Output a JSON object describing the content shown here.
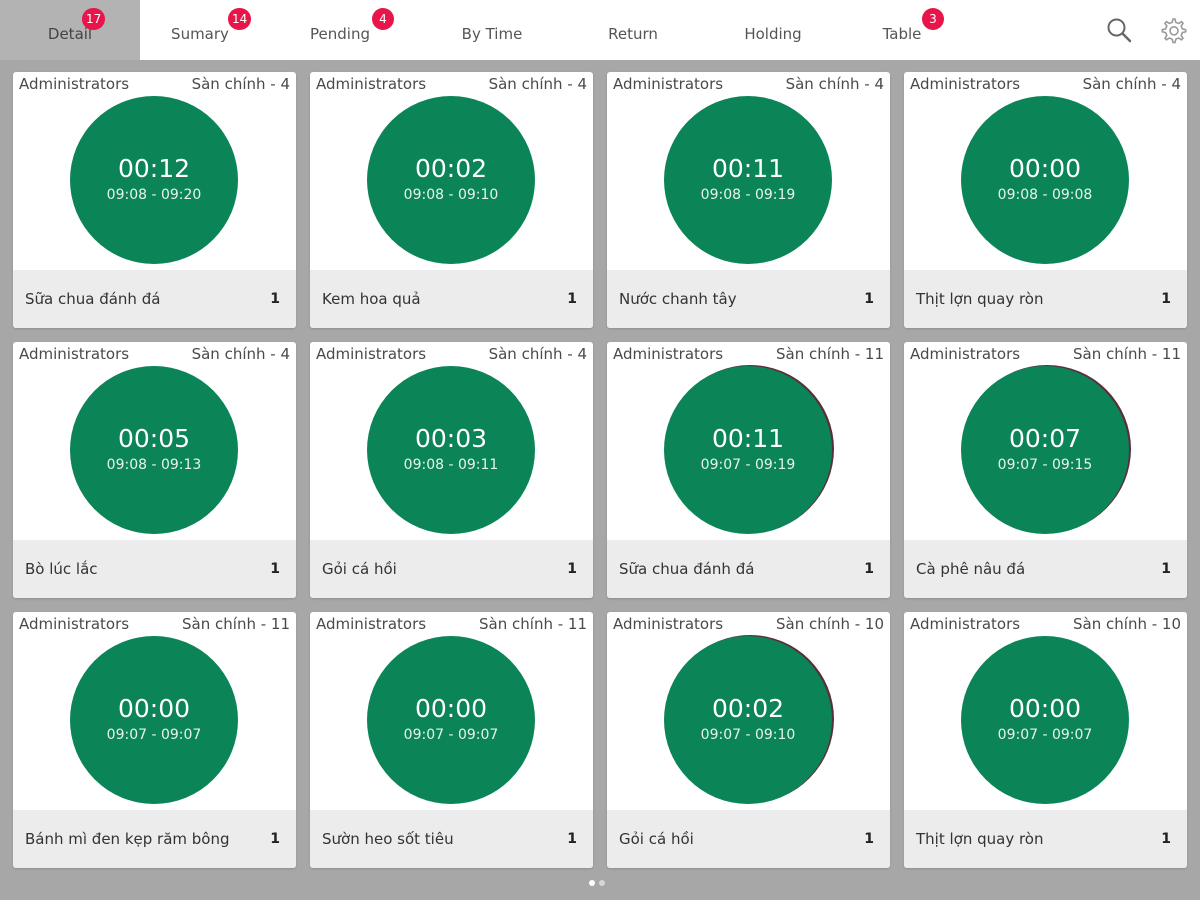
{
  "tabs": [
    {
      "label": "Detail",
      "badge": "17"
    },
    {
      "label": "Sumary",
      "badge": "14"
    },
    {
      "label": "Pending",
      "badge": "4"
    },
    {
      "label": "By Time",
      "badge": ""
    },
    {
      "label": "Return",
      "badge": ""
    },
    {
      "label": "Holding",
      "badge": ""
    },
    {
      "label": "Table",
      "badge": "3"
    }
  ],
  "active_tab": "Detail",
  "tools": {
    "search_icon": "search-icon",
    "settings_icon": "gear-icon"
  },
  "colors": {
    "accent_green": "#0b8457",
    "badge_red": "#e8154a",
    "background": "#a7a7a7"
  },
  "orders": [
    {
      "user": "Administrators",
      "table": "Sàn chính - 4",
      "elapsed": "00:12",
      "range": "09:08 - 09:20",
      "item": "Sữa chua đánh đá",
      "qty": "1"
    },
    {
      "user": "Administrators",
      "table": "Sàn chính - 4",
      "elapsed": "00:02",
      "range": "09:08 - 09:10",
      "item": "Kem hoa quả",
      "qty": "1"
    },
    {
      "user": "Administrators",
      "table": "Sàn chính - 4",
      "elapsed": "00:11",
      "range": "09:08 - 09:19",
      "item": "Nước chanh tây",
      "qty": "1"
    },
    {
      "user": "Administrators",
      "table": "Sàn chính - 4",
      "elapsed": "00:00",
      "range": "09:08 - 09:08",
      "item": "Thịt lợn quay ròn",
      "qty": "1"
    },
    {
      "user": "Administrators",
      "table": "Sàn chính - 4",
      "elapsed": "00:05",
      "range": "09:08 - 09:13",
      "item": "Bò lúc lắc",
      "qty": "1"
    },
    {
      "user": "Administrators",
      "table": "Sàn chính - 4",
      "elapsed": "00:03",
      "range": "09:08 - 09:11",
      "item": "Gỏi cá hồi",
      "qty": "1"
    },
    {
      "user": "Administrators",
      "table": "Sàn chính - 11",
      "elapsed": "00:11",
      "range": "09:07 - 09:19",
      "item": "Sữa chua đánh đá",
      "qty": "1"
    },
    {
      "user": "Administrators",
      "table": "Sàn chính - 11",
      "elapsed": "00:07",
      "range": "09:07 - 09:15",
      "item": "Cà phê nâu đá",
      "qty": "1"
    },
    {
      "user": "Administrators",
      "table": "Sàn chính - 11",
      "elapsed": "00:00",
      "range": "09:07 - 09:07",
      "item": "Bánh mì đen kẹp răm bông",
      "qty": "1"
    },
    {
      "user": "Administrators",
      "table": "Sàn chính - 11",
      "elapsed": "00:00",
      "range": "09:07 - 09:07",
      "item": "Sườn heo sốt tiêu",
      "qty": "1"
    },
    {
      "user": "Administrators",
      "table": "Sàn chính - 10",
      "elapsed": "00:02",
      "range": "09:07 - 09:10",
      "item": "Gỏi cá hồi",
      "qty": "1"
    },
    {
      "user": "Administrators",
      "table": "Sàn chính - 10",
      "elapsed": "00:00",
      "range": "09:07 - 09:07",
      "item": "Thịt lợn quay ròn",
      "qty": "1"
    }
  ],
  "pager": {
    "pages": 2,
    "current": 1
  }
}
